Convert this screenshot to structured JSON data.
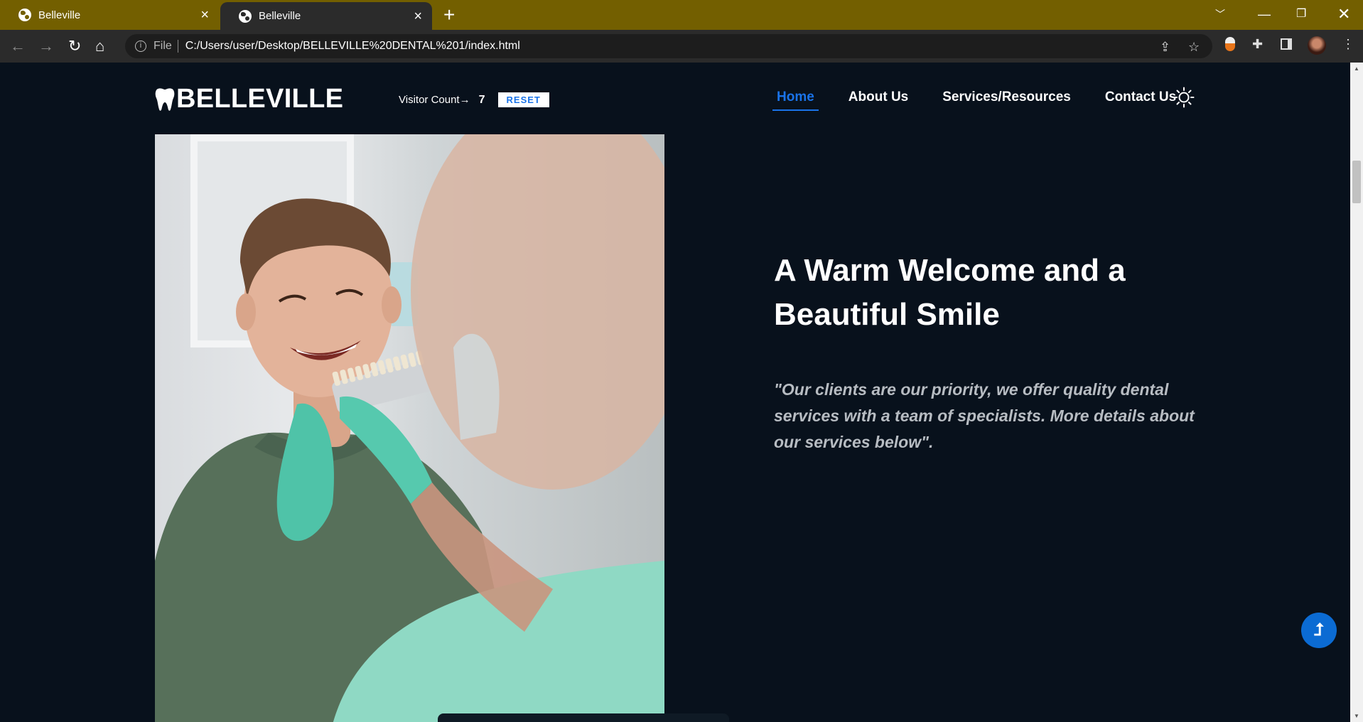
{
  "browser": {
    "tabs": [
      {
        "title": "Belleville",
        "active": false
      },
      {
        "title": "Belleville",
        "active": true
      }
    ],
    "new_tab": "+",
    "url_scheme": "File",
    "url": "C:/Users/user/Desktop/BELLEVILLE%20DENTAL%201/index.html",
    "colors": {
      "tabstrip": "#735f00",
      "toolbar": "#2b2b2b"
    }
  },
  "site": {
    "logo_text": "BELLEVILLE",
    "visitor_label": "Visitor Count→",
    "visitor_count": "7",
    "reset_label": "RESET",
    "nav": [
      {
        "label": "Home",
        "active": true
      },
      {
        "label": "About Us",
        "active": false
      },
      {
        "label": "Services/Resources",
        "active": false
      },
      {
        "label": "Contact Us",
        "active": false
      }
    ],
    "theme_toggle_icon": "sun-icon",
    "hero": {
      "headline_part1": "A Warm ",
      "headline_bold1": "Welcome",
      "headline_part2": " and a Beautiful ",
      "headline_bold2": "Smile",
      "quote": "\"Our clients are our priority, we offer quality dental services with a team of specialists. More details about our services below\"."
    },
    "colors": {
      "background": "#08111c",
      "accent": "#1a73e8",
      "scroll_top_button": "#0b6bd3"
    }
  }
}
